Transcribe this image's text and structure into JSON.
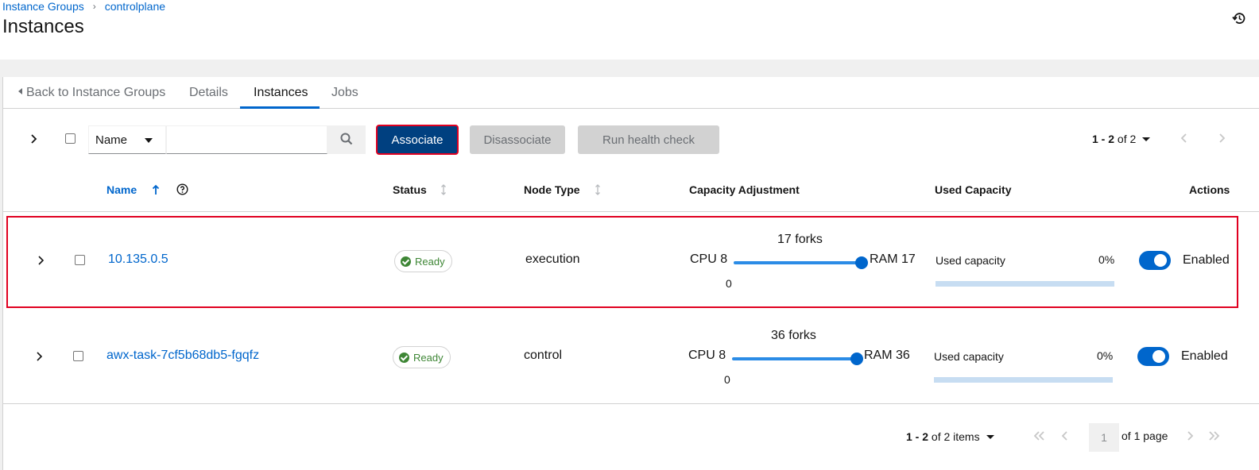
{
  "breadcrumb": {
    "parent": "Instance Groups",
    "current": "controlplane"
  },
  "page_title": "Instances",
  "tabs": {
    "back": "Back to Instance Groups",
    "details": "Details",
    "instances": "Instances",
    "jobs": "Jobs"
  },
  "toolbar": {
    "filter_select": "Name",
    "search_placeholder": "",
    "associate": "Associate",
    "disassociate": "Disassociate",
    "health_check": "Run health check",
    "pagination_range": "1 - 2",
    "pagination_total": "of 2"
  },
  "columns": {
    "name": "Name",
    "status": "Status",
    "node_type": "Node Type",
    "capacity_adjustment": "Capacity Adjustment",
    "used_capacity": "Used Capacity",
    "actions": "Actions"
  },
  "rows": [
    {
      "name": "10.135.0.5",
      "status": "Ready",
      "node_type": "execution",
      "forks": "17 forks",
      "cpu": "CPU 8",
      "ram": "RAM 17",
      "min": "0",
      "slider_fraction": 1.0,
      "used_label": "Used capacity",
      "used_pct": "0%",
      "used_fraction": 0,
      "enabled_label": "Enabled",
      "enabled": true
    },
    {
      "name": "awx-task-7cf5b68db5-fgqfz",
      "status": "Ready",
      "node_type": "control",
      "forks": "36 forks",
      "cpu": "CPU 8",
      "ram": "RAM 36",
      "min": "0",
      "slider_fraction": 1.0,
      "used_label": "Used capacity",
      "used_pct": "0%",
      "used_fraction": 0,
      "enabled_label": "Enabled",
      "enabled": true
    }
  ],
  "footer": {
    "range": "1 - 2",
    "total": "of 2 items",
    "page": "1",
    "of_pages": "of 1 page"
  },
  "colors": {
    "link": "#0066cc",
    "primary": "#004080",
    "success": "#3e8635",
    "highlight": "#e00020"
  }
}
